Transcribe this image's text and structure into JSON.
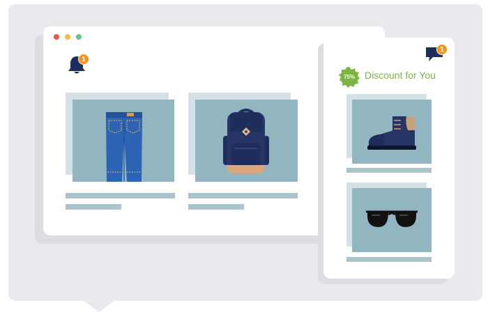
{
  "browser": {
    "notification_count": "1"
  },
  "products": [
    {
      "name_icon": "jeans-icon"
    },
    {
      "name_icon": "backpack-icon"
    }
  ],
  "side_popup": {
    "message_count": "1",
    "discount_badge": "75%",
    "title": "Discount for You",
    "items": [
      {
        "name_icon": "boot-icon"
      },
      {
        "name_icon": "sunglasses-icon"
      }
    ]
  },
  "colors": {
    "accent_green": "#7cb342",
    "badge_orange": "#f7941d",
    "navy": "#1f2d5c",
    "card_blue": "#92b6c0"
  }
}
